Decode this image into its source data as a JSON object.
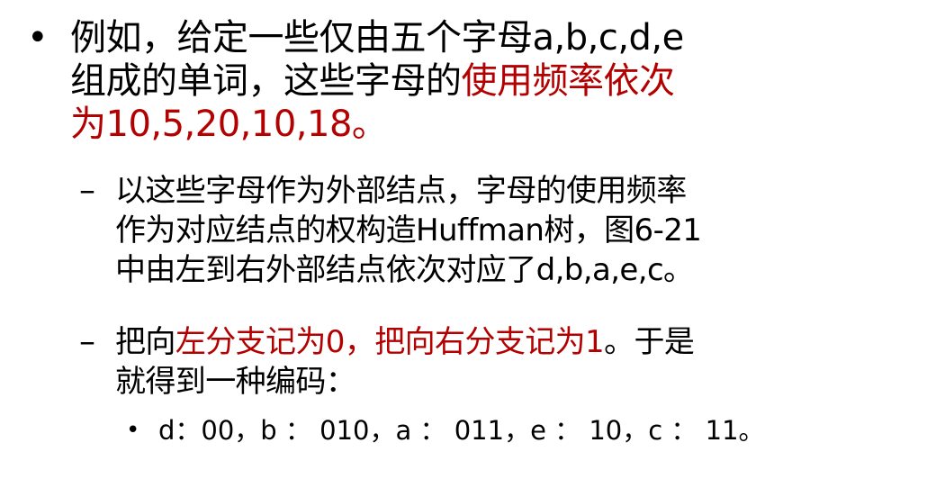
{
  "bullet1": {
    "marker": "•",
    "line1": "例如，给定一些仅由五个字母a,b,c,d,e",
    "line2_black": "组成的单词，这些字母的",
    "line2_red": "使用频率依次",
    "line3_red": "为10,5,20,10,18。"
  },
  "sub1": {
    "marker": "–",
    "line1": "以这些字母作为外部结点，字母的使用频率",
    "line2": "作为对应结点的权构造Huffman树，图6-21",
    "line3": "中由左到右外部结点依次对应了d,b,a,e,c。"
  },
  "sub2": {
    "marker": "–",
    "line1_black_a": "把向",
    "line1_red": "左分支记为0，把向右分支记为1",
    "line1_black_b": "。于是",
    "line2": "就得到一种编码："
  },
  "code": {
    "marker": "•",
    "text": "d：00，b ： 010，a ： 011，e ： 10，c ： 11。"
  },
  "colors": {
    "emphasis": "#b30000",
    "text": "#000000",
    "background": "#ffffff"
  }
}
